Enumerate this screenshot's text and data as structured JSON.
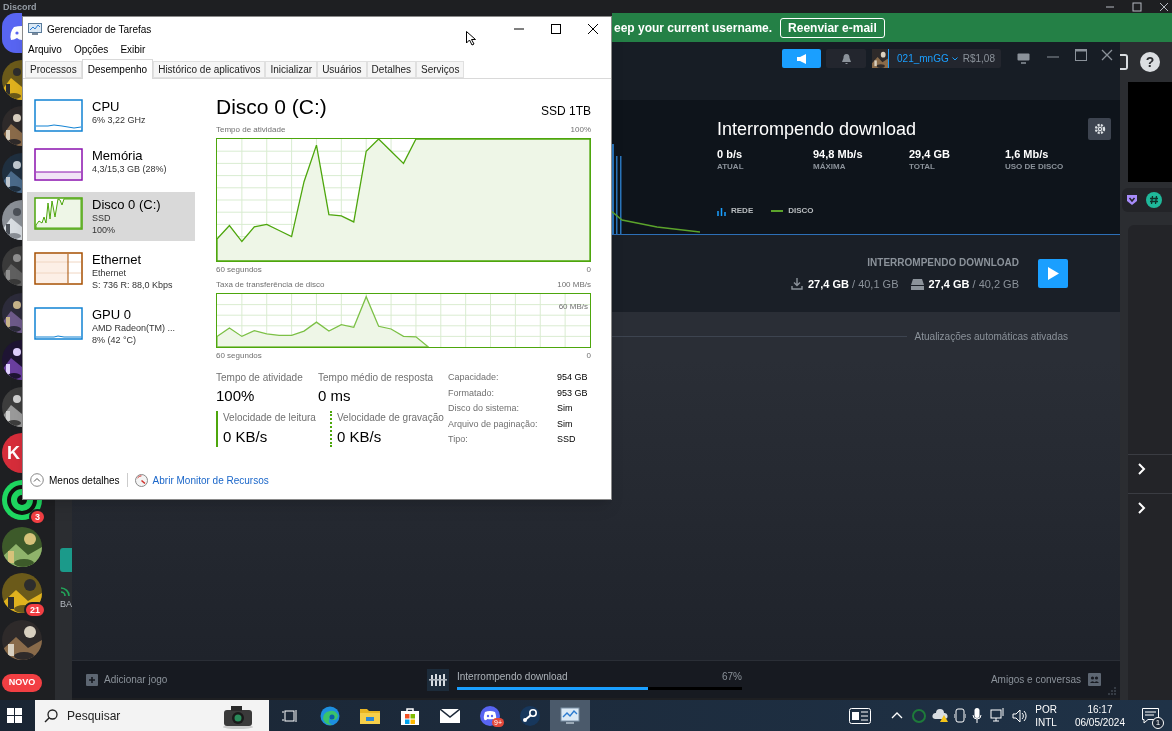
{
  "discord": {
    "title": "Discord",
    "servers": [
      {
        "kind": "home"
      },
      {
        "kind": "picture"
      },
      {
        "kind": "picture"
      },
      {
        "kind": "picture"
      },
      {
        "kind": "picture"
      },
      {
        "kind": "picture"
      },
      {
        "kind": "picture"
      },
      {
        "kind": "picture"
      },
      {
        "kind": "picture"
      },
      {
        "kind": "letter",
        "text": "K"
      },
      {
        "kind": "mark",
        "badge": "3"
      },
      {
        "kind": "picture"
      },
      {
        "kind": "picture",
        "badge": "21"
      },
      {
        "kind": "picture"
      }
    ],
    "new_badge": "NOVO",
    "channel_fragment": "BA",
    "help": "?",
    "banner": {
      "text": "eep your current username.",
      "button": "Reenviar e-mail"
    }
  },
  "steam": {
    "username": "021_mnGG",
    "balance": "R$1,08",
    "downloads": {
      "title": "Interrompendo download",
      "stats": [
        {
          "value": "0 b/s",
          "label": "ATUAL"
        },
        {
          "value": "94,8 Mb/s",
          "label": "MÁXIMA"
        },
        {
          "value": "29,4 GB",
          "label": "TOTAL"
        },
        {
          "value": "1,6 Mb/s",
          "label": "USO DE DISCO"
        }
      ],
      "legend": [
        {
          "kind": "network",
          "label": "REDE"
        },
        {
          "kind": "disk",
          "label": "DISCO"
        }
      ]
    },
    "game": {
      "status": "INTERROMPENDO DOWNLOAD",
      "download": "**27,4 GB** / 40,1 GB",
      "disk": "**27,4 GB** / 40,2 GB"
    },
    "auto_updates": "Atualizações automáticas ativadas",
    "footer": {
      "add_game": "Adicionar jogo",
      "status": "Interrompendo download",
      "level": 0.67,
      "percent": "67%",
      "friends": "Amigos e conversas"
    }
  },
  "task_manager": {
    "title": "Gerenciador de Tarefas",
    "menu": [
      "Arquivo",
      "Opções",
      "Exibir"
    ],
    "tabs": [
      {
        "label": "Processos",
        "selected": false
      },
      {
        "label": "Desempenho",
        "selected": true
      },
      {
        "label": "Histórico de aplicativos",
        "selected": false
      },
      {
        "label": "Inicializar",
        "selected": false
      },
      {
        "label": "Usuários",
        "selected": false
      },
      {
        "label": "Detalhes",
        "selected": false
      },
      {
        "label": "Serviços",
        "selected": false
      }
    ],
    "devices": [
      {
        "kind": "cpu",
        "name": "CPU",
        "details": [
          "6% 3,22 GHz"
        ],
        "selected": false
      },
      {
        "kind": "memory",
        "name": "Memória",
        "details": [
          "4,3/15,3 GB (28%)"
        ],
        "selected": false
      },
      {
        "kind": "disk",
        "name": "Disco 0 (C:)",
        "details": [
          "SSD",
          "100%"
        ],
        "selected": true
      },
      {
        "kind": "network",
        "name": "Ethernet",
        "details": [
          "Ethernet",
          "S: 736 R: 88,0 Kbps"
        ],
        "selected": false
      },
      {
        "kind": "gpu",
        "name": "GPU 0",
        "details": [
          "AMD Radeon(TM) ...",
          "8% (42 °C)"
        ],
        "selected": false
      }
    ],
    "detail": {
      "title": "Disco 0 (C:)",
      "model": "SSD 1TB",
      "graphs": [
        {
          "kind": "activity",
          "title": "Tempo de atividade",
          "scale": "100%",
          "span": "60 segundos",
          "end": "0"
        },
        {
          "kind": "transfer",
          "title": "Taxa de transferência de disco",
          "scale": "100 MB/s",
          "guide": "60 MB/s",
          "span": "60 segundos",
          "end": "0"
        }
      ],
      "stats": [
        {
          "label": "Tempo de atividade",
          "value": "100%"
        },
        {
          "label": "Tempo médio de resposta",
          "value": "0 ms"
        }
      ],
      "speeds": [
        {
          "kind": "read",
          "label": "Velocidade de leitura",
          "value": "0 KB/s"
        },
        {
          "kind": "write",
          "label": "Velocidade de gravação",
          "value": "0 KB/s"
        }
      ],
      "properties": [
        {
          "label": "Capacidade:",
          "value": "954 GB"
        },
        {
          "label": "Formatado:",
          "value": "953 GB"
        },
        {
          "label": "Disco do sistema:",
          "value": "Sim"
        },
        {
          "label": "Arquivo de paginação:",
          "value": "Sim"
        },
        {
          "label": "Tipo:",
          "value": "SSD"
        }
      ]
    },
    "footer": {
      "less": "Menos detalhes",
      "link": "Abrir Monitor de Recursos"
    }
  },
  "taskbar": {
    "search_placeholder": "Pesquisar",
    "apps": [
      {
        "kind": "task-view",
        "selected": false
      },
      {
        "kind": "edge",
        "selected": false
      },
      {
        "kind": "explorer",
        "selected": false
      },
      {
        "kind": "store",
        "selected": false
      },
      {
        "kind": "mail",
        "selected": false
      },
      {
        "kind": "discord",
        "selected": false,
        "badge": "9+"
      },
      {
        "kind": "steam",
        "selected": false
      },
      {
        "kind": "task-manager",
        "selected": true
      }
    ],
    "language": "POR",
    "layout": "INTL",
    "time": "16:17",
    "date": "06/05/2024",
    "notifications": "1"
  }
}
